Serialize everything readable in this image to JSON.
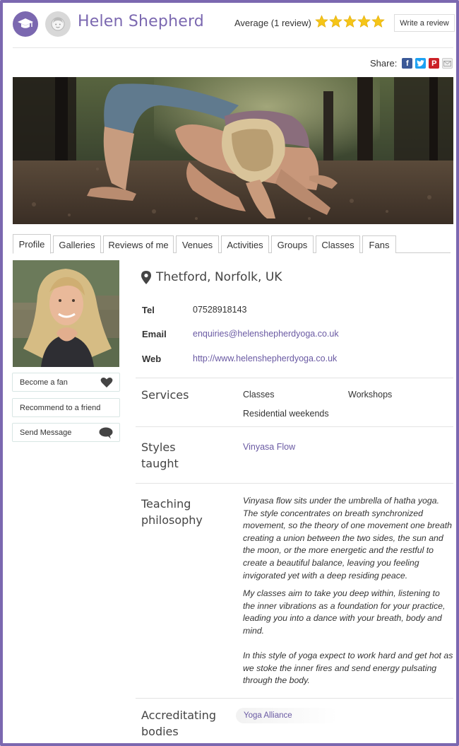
{
  "header": {
    "name": "Helen Shepherd",
    "rating_text": "Average (1 review)",
    "rating_stars": 5,
    "write_review_label": "Write a review"
  },
  "share": {
    "label": "Share:",
    "icons": [
      "facebook-icon",
      "twitter-icon",
      "pinterest-icon",
      "email-icon"
    ]
  },
  "tabs": [
    "Profile",
    "Galleries",
    "Reviews of me",
    "Venues",
    "Activities",
    "Groups",
    "Classes",
    "Fans"
  ],
  "active_tab": "Profile",
  "sidebar": {
    "become_fan": "Become a fan",
    "recommend": "Recommend to a friend",
    "send_message": "Send Message"
  },
  "profile": {
    "location": "Thetford, Norfolk, UK",
    "tel_label": "Tel",
    "tel": "07528918143",
    "email_label": "Email",
    "email": "enquiries@helenshepherdyoga.co.uk",
    "web_label": "Web",
    "web": "http://www.helenshepherdyoga.co.uk"
  },
  "services": {
    "label": "Services",
    "items": [
      "Classes",
      "Workshops",
      "Residential weekends"
    ]
  },
  "styles": {
    "label_line1": "Styles",
    "label_line2": "taught",
    "value": "Vinyasa Flow"
  },
  "philosophy": {
    "label_line1": "Teaching",
    "label_line2": "philosophy",
    "para1": "Vinyasa flow sits under the umbrella of hatha yoga. The style concentrates on breath synchronized movement, so the theory of one movement one breath creating a union between the two sides, the sun and the moon, or the more energetic and the restful to create a beautiful balance, leaving you feeling invigorated yet with a deep residing peace.",
    "para2": "My classes aim to take you deep within, listening to the inner vibrations as a foundation for your practice, leading you into a dance with your breath, body and mind.",
    "para3": "In this style of yoga expect to work hard and get hot as we stoke the inner fires and send energy pulsating through the body."
  },
  "accreditation": {
    "label_line1": "Accreditating",
    "label_line2": "bodies",
    "value": "Yoga Alliance"
  },
  "colors": {
    "brand": "#7b68b0",
    "link": "#6a5aa3",
    "star": "#f5c518"
  }
}
